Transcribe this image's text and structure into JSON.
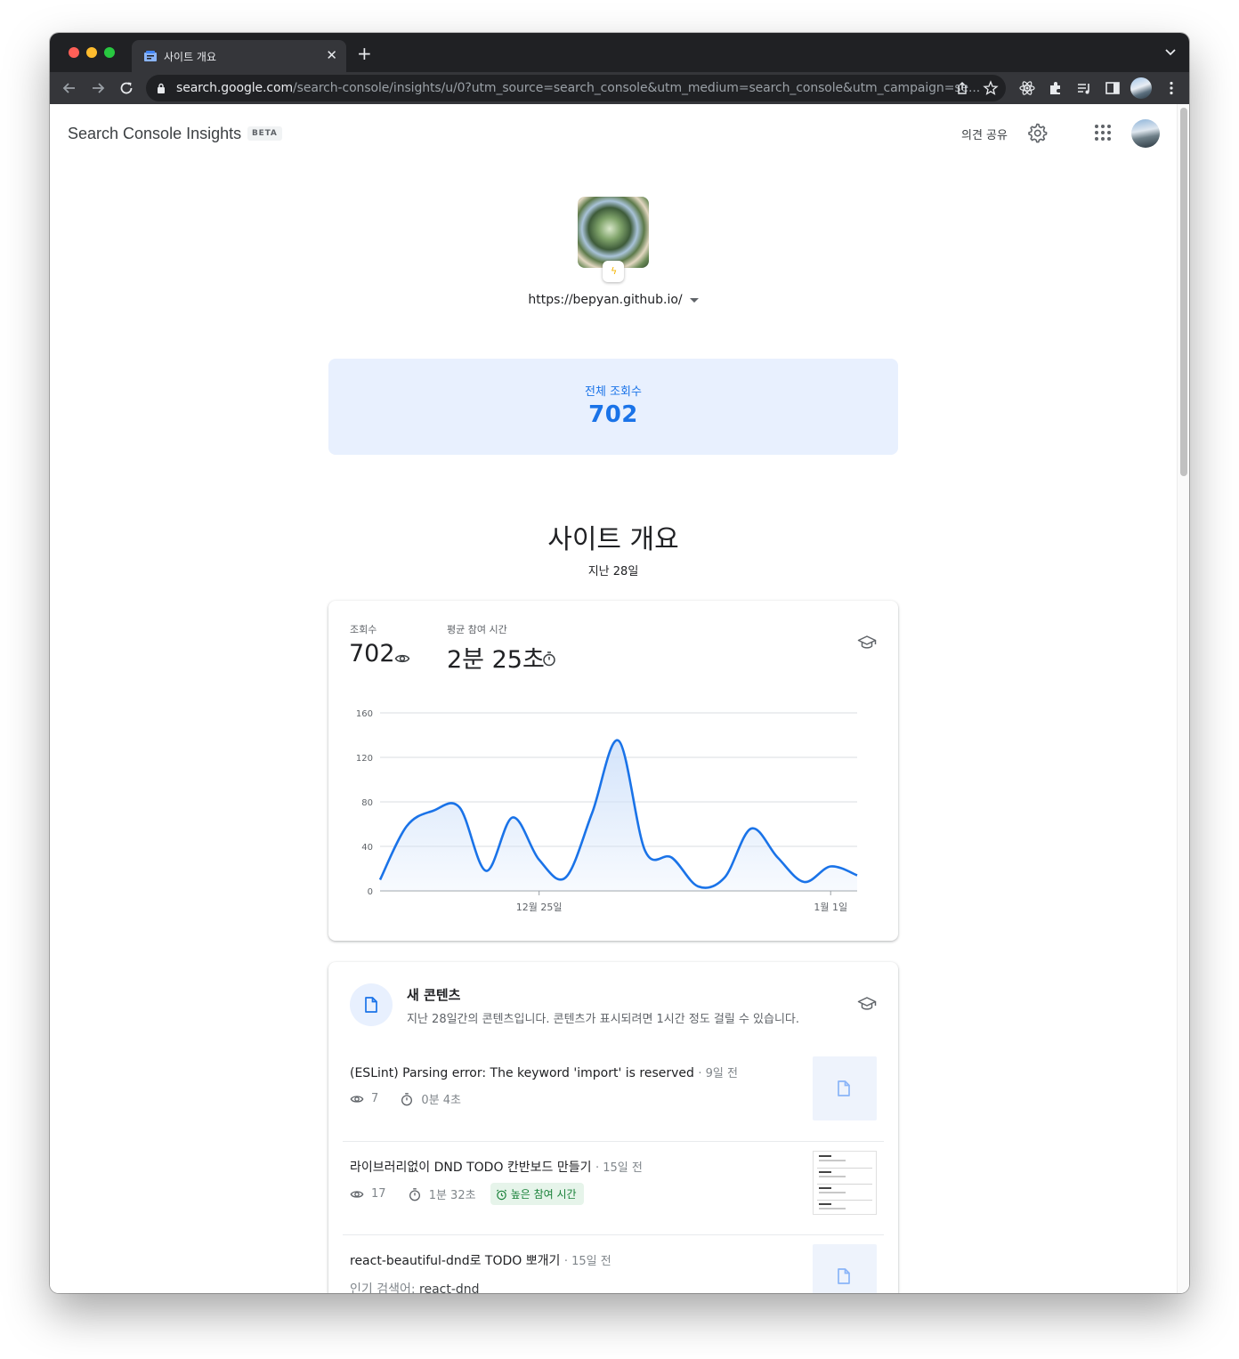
{
  "browser": {
    "tab_title": "사이트 개요",
    "url_host": "search.google.com",
    "url_path": "/search-console/insights/u/0?utm_source=search_console&utm_medium=search_console&utm_campaign=se..."
  },
  "header": {
    "brand": "Search Console Insights",
    "beta": "BETA",
    "feedback": "의견 공유"
  },
  "site": {
    "url": "https://bepyan.github.io/"
  },
  "total": {
    "label": "전체 조회수",
    "value": "702"
  },
  "overview": {
    "title": "사이트 개요",
    "subtitle": "지난 28일",
    "views_label": "조회수",
    "views_value": "702",
    "time_label": "평균 참여 시간",
    "time_value": "2분 25초"
  },
  "chart_data": {
    "type": "area",
    "y_ticks": [
      "160",
      "120",
      "80",
      "40",
      "0"
    ],
    "ylim": [
      0,
      160
    ],
    "x_tick_labels": [
      {
        "label": "12월 25일",
        "index": 6
      },
      {
        "label": "1월 1일",
        "index": 17
      }
    ],
    "values": [
      10,
      58,
      72,
      75,
      18,
      66,
      28,
      12,
      70,
      135,
      36,
      30,
      4,
      12,
      56,
      30,
      8,
      22,
      14
    ],
    "grid": true,
    "colors": {
      "line": "#1a73e8",
      "fill": "#cfe1fa"
    }
  },
  "new_content": {
    "title": "새 콘텐츠",
    "description": "지난 28일간의 콘텐츠입니다. 콘텐츠가 표시되려면 1시간 정도 걸릴 수 있습니다.",
    "items": [
      {
        "title": "(ESLint) Parsing error: The keyword 'import' is reserved",
        "age": "9일 전",
        "views": "7",
        "time": "0분 4초"
      },
      {
        "title": "라이브러리없이 DND TODO 칸반보드 만들기",
        "age": "15일 전",
        "views": "17",
        "time": "1분 32초",
        "chip": "높은 참여 시간"
      },
      {
        "title": "react-beautiful-dnd로 TODO 뽀개기",
        "age": "15일 전",
        "query_label": "인기 검색어:",
        "query": "react-dnd"
      }
    ]
  }
}
